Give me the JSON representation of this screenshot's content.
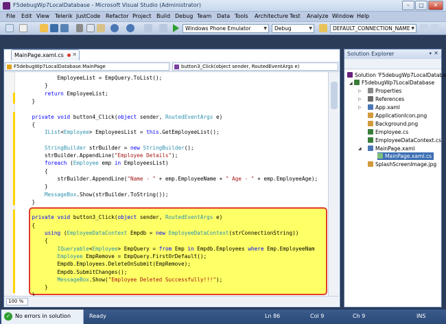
{
  "window": {
    "title": "F5debugWp7LocalDatabase - Microsoft Visual Studio (Administrator)"
  },
  "menu": [
    "File",
    "Edit",
    "View",
    "Telerik",
    "JustCode",
    "Refactor",
    "Project",
    "Build",
    "Debug",
    "Team",
    "Data",
    "Tools",
    "Architecture",
    "Test",
    "Analyze",
    "Window",
    "Help"
  ],
  "toolbar": {
    "target": "Windows Phone Emulator",
    "config": "Debug",
    "find": "DEFAULT_CONNECTION_NAME"
  },
  "editor": {
    "tab": "MainPage.xaml.cs",
    "nav_class": "F5debugWp7LocalDatabase.MainPage",
    "nav_member": "button3_Click(object sender, RoutedEventArgs e)",
    "zoom": "100 %"
  },
  "code": [
    "            EmployeeList = EmpQuery.ToList();",
    "        }",
    "        return EmployeeList;",
    "    }",
    "",
    "    private void button4_Click(object sender, RoutedEventArgs e)",
    "    {",
    "        IList<Employee> EmployeesList = this.GetEmployeeList();",
    "",
    "        StringBuilder strBuilder = new StringBuilder();",
    "        strBuilder.AppendLine(\"Employee Details\");",
    "        foreach (Employee emp in EmployeesList)",
    "        {",
    "            strBuilder.AppendLine(\"Name - \" + emp.EmployeeName + \" Age - \" + emp.EmployeeAge);",
    "        }",
    "        MessageBox.Show(strBuilder.ToString());",
    "    }",
    "",
    "    private void button3_Click(object sender, RoutedEventArgs e)",
    "    {",
    "        using (EmployeeDataContext Empdb = new EmployeeDataContext(strConnectionString))",
    "        {",
    "            IQueryable<Employee> EmpQuery = from Emp in Empdb.Employees where Emp.EmployeeNam",
    "            Employee EmpRemove = EmpQuery.FirstOrDefault();",
    "            Empdb.Employees.DeleteOnSubmit(EmpRemove);",
    "            Empdb.SubmitChanges();",
    "            MessageBox.Show(\"Employee Deleted Successfully!!!\");",
    "        }",
    "    }"
  ],
  "solution_explorer": {
    "title": "Solution Explorer",
    "solution": "Solution 'F5debugWp7LocalDatabase'",
    "project": "F5debugWp7LocalDatabase",
    "items": [
      "Properties",
      "References",
      "App.xaml",
      "ApplicationIcon.png",
      "Background.png",
      "Employee.cs",
      "EmployeeDataContext.cs",
      "MainPage.xaml",
      "MainPage.xaml.cs",
      "SplashScreenImage.jpg"
    ]
  },
  "status": {
    "errors": "No errors in solution",
    "ready": "Ready",
    "ln": "Ln 86",
    "col": "Col 9",
    "ch": "Ch 9",
    "ins": "INS"
  },
  "colors": {
    "keyword": "#0000ff",
    "type": "#2b91af",
    "string": "#a31515",
    "highlight": "#ffff66",
    "highlight_border": "#e03c2c"
  }
}
